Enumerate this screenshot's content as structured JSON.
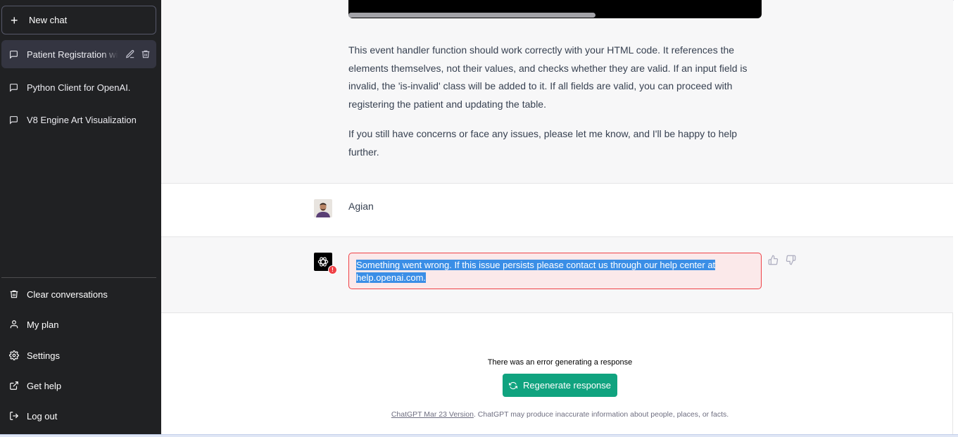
{
  "sidebar": {
    "new_chat_label": "New chat",
    "conversations": [
      {
        "label": "Patient Registration with",
        "active": true
      },
      {
        "label": "Python Client for OpenAI.",
        "active": false
      },
      {
        "label": "V8 Engine Art Visualization",
        "active": false
      }
    ],
    "menu": {
      "clear": "Clear conversations",
      "plan": "My plan",
      "settings": "Settings",
      "help": "Get help",
      "logout": "Log out"
    }
  },
  "chat": {
    "assistant_paragraphs": [
      "This event handler function should work correctly with your HTML code. It references the elements themselves, not their values, and checks whether they are valid. If an input field is invalid, the 'is-invalid' class will be added to it. If all fields are valid, you can proceed with registering the patient and updating the table.",
      "If you still have concerns or face any issues, please let me know, and I'll be happy to help further."
    ],
    "user_name": "Agian",
    "error_text": "Something went wrong. If this issue persists please contact us through our help center at help.openai.com."
  },
  "status": {
    "error_message": "There was an error generating a response",
    "regenerate_label": "Regenerate response"
  },
  "footer": {
    "version_link": "ChatGPT Mar 23 Version",
    "disclaimer": ". ChatGPT may produce inaccurate information about people, places, or facts."
  },
  "colors": {
    "sidebar_bg": "#202123",
    "accent": "#10a37f",
    "error": "#ef4146",
    "selection": "#3a8ee6"
  }
}
